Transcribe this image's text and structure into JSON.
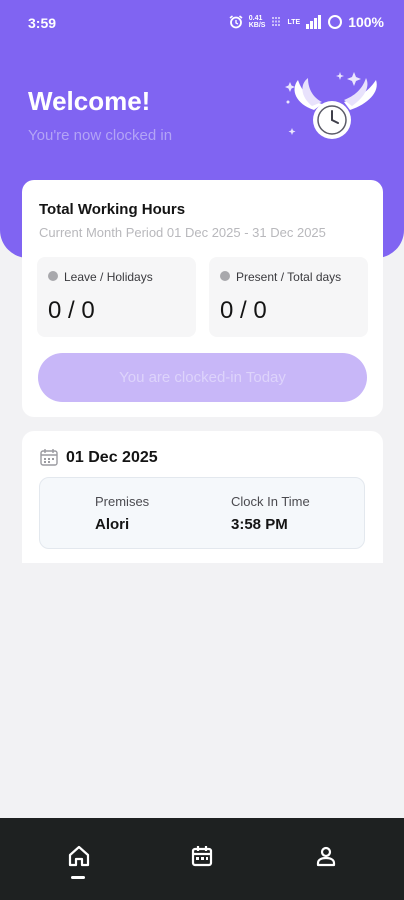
{
  "status_bar": {
    "time": "3:59",
    "speed_top": "0.41",
    "speed_bottom": "KB/S",
    "network": "LTE",
    "battery": "100%"
  },
  "header": {
    "title": "Welcome!",
    "subtitle": "You're now clocked in"
  },
  "working_hours": {
    "title": "Total Working Hours",
    "period": "Current Month Period 01 Dec 2025 - 31 Dec 2025",
    "stats": [
      {
        "label": "Leave / Holidays",
        "value": "0 / 0"
      },
      {
        "label": "Present / Total days",
        "value": "0 / 0"
      }
    ],
    "button_label": "You are clocked-in Today"
  },
  "attendance": {
    "date": "01 Dec 2025",
    "premises_label": "Premises",
    "premises_value": "Alori",
    "clock_in_label": "Clock In Time",
    "clock_in_value": "3:58 PM"
  },
  "nav": {
    "items": [
      {
        "icon": "home-icon",
        "active": true
      },
      {
        "icon": "calendar-icon",
        "active": false
      },
      {
        "icon": "profile-icon",
        "active": false
      }
    ]
  },
  "colors": {
    "accent": "#8064f2",
    "button_disabled": "#c8b7f8",
    "nav_background": "#1e2121"
  }
}
